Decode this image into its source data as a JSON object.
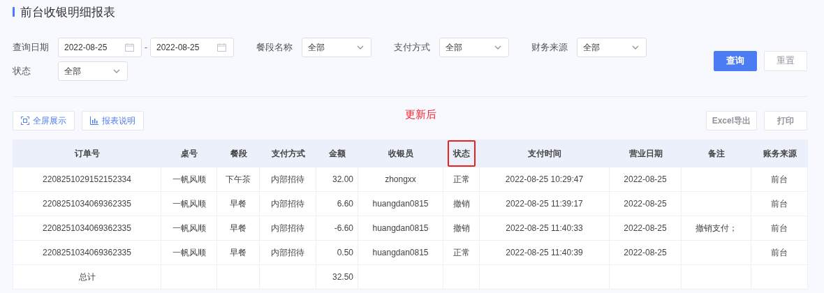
{
  "page_title": "前台收银明细报表",
  "filters": [
    {
      "kind": "date_range",
      "label": "查询日期",
      "from": "2022-08-25",
      "separator": "-",
      "to": "2022-08-25"
    },
    {
      "kind": "select",
      "label": "餐段名称",
      "value": "全部"
    },
    {
      "kind": "select",
      "label": "支付方式",
      "value": "全部"
    },
    {
      "kind": "select",
      "label": "财务来源",
      "value": "全部"
    },
    {
      "kind": "select",
      "label": "状态",
      "value": "全部"
    }
  ],
  "filter_buttons": [
    {
      "label": "查询",
      "primary": true
    },
    {
      "label": "重置",
      "primary": false
    }
  ],
  "toolbar_left": [
    {
      "label": "全屏展示",
      "kind": "fullscreen"
    },
    {
      "label": "报表说明",
      "kind": "chart"
    }
  ],
  "annotation": "更新后",
  "toolbar_right": [
    "Excel导出",
    "打印"
  ],
  "table": {
    "columns": [
      {
        "label": "订单号",
        "highlighted": false
      },
      {
        "label": "桌号",
        "highlighted": false
      },
      {
        "label": "餐段",
        "highlighted": false
      },
      {
        "label": "支付方式",
        "highlighted": false
      },
      {
        "label": "金额",
        "highlighted": false
      },
      {
        "label": "收银员",
        "highlighted": false
      },
      {
        "label": "状态",
        "highlighted": true
      },
      {
        "label": "支付时间",
        "highlighted": false
      },
      {
        "label": "营业日期",
        "highlighted": false
      },
      {
        "label": "备注",
        "highlighted": false
      },
      {
        "label": "账务来源",
        "highlighted": false
      }
    ],
    "rows": [
      [
        "2208251029152152334",
        "一帆风顺",
        "下午茶",
        "内部招待",
        "32.00",
        "zhongxx",
        "正常",
        "2022-08-25 10:29:47",
        "2022-08-25",
        "",
        "前台"
      ],
      [
        "2208251034069362335",
        "一帆风顺",
        "早餐",
        "内部招待",
        "6.60",
        "huangdan0815",
        "撤销",
        "2022-08-25 11:39:17",
        "2022-08-25",
        "",
        "前台"
      ],
      [
        "2208251034069362335",
        "一帆风顺",
        "早餐",
        "内部招待",
        "-6.60",
        "huangdan0815",
        "撤销",
        "2022-08-25 11:40:33",
        "2022-08-25",
        "撤销支付；",
        "前台"
      ],
      [
        "2208251034069362335",
        "一帆风顺",
        "早餐",
        "内部招待",
        "0.50",
        "huangdan0815",
        "正常",
        "2022-08-25 11:40:39",
        "2022-08-25",
        "",
        "前台"
      ],
      [
        "总计",
        "",
        "",
        "",
        "32.50",
        "",
        "",
        "",
        "",
        "",
        ""
      ]
    ]
  }
}
